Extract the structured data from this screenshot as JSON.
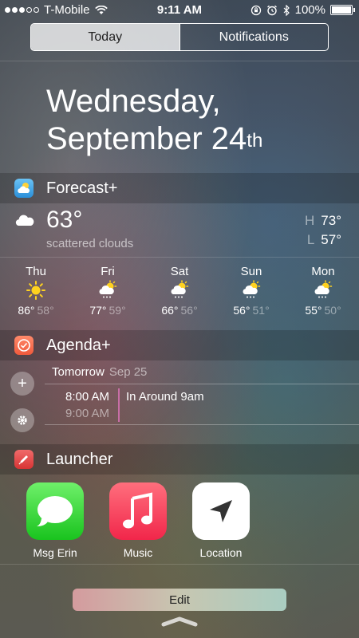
{
  "status_bar": {
    "carrier": "T-Mobile",
    "time": "9:11 AM",
    "battery": "100%"
  },
  "tabs": [
    {
      "label": "Today"
    },
    {
      "label": "Notifications"
    }
  ],
  "date": {
    "weekday": "Wednesday,",
    "month_day": "September 24",
    "suffix": "th"
  },
  "forecast": {
    "title": "Forecast+",
    "current_temp": "63°",
    "condition": "scattered clouds",
    "high_label": "H",
    "high": "73°",
    "low_label": "L",
    "low": "57°",
    "days": [
      {
        "name": "Thu",
        "hi": "86°",
        "lo": "58°",
        "icon": "sun-icon"
      },
      {
        "name": "Fri",
        "hi": "77°",
        "lo": "59°",
        "icon": "partly-cloudy-snow-icon"
      },
      {
        "name": "Sat",
        "hi": "66°",
        "lo": "56°",
        "icon": "partly-cloudy-snow-icon"
      },
      {
        "name": "Sun",
        "hi": "56°",
        "lo": "51°",
        "icon": "partly-cloudy-snow-icon"
      },
      {
        "name": "Mon",
        "hi": "55°",
        "lo": "50°",
        "icon": "partly-cloudy-snow-icon"
      }
    ]
  },
  "agenda": {
    "title": "Agenda+",
    "day": "Tomorrow",
    "day_date": "Sep 25",
    "event": {
      "start": "8:00 AM",
      "end": "9:00 AM",
      "title": "In Around 9am"
    },
    "add_symbol": "+"
  },
  "launcher": {
    "title": "Launcher",
    "apps": [
      {
        "label": "Msg Erin",
        "icon": "messages-icon"
      },
      {
        "label": "Music",
        "icon": "music-note-icon"
      },
      {
        "label": "Location",
        "icon": "location-arrow-icon"
      }
    ]
  },
  "edit_label": "Edit"
}
